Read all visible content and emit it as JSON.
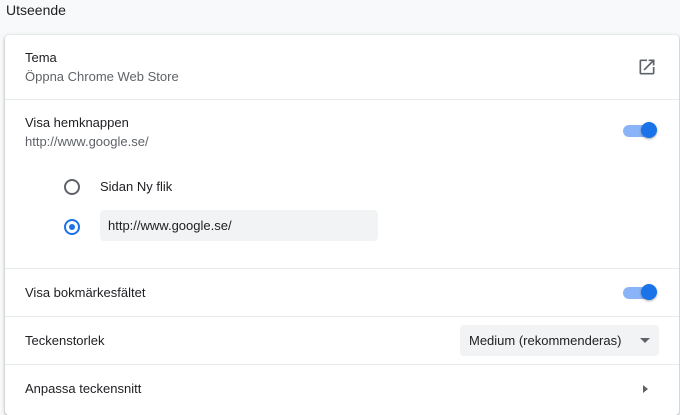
{
  "section": {
    "title": "Utseende"
  },
  "theme": {
    "title": "Tema",
    "subtitle": "Öppna Chrome Web Store",
    "icon": "open-in-new-icon"
  },
  "home_button": {
    "title": "Visa hemknappen",
    "subtitle": "http://www.google.se/",
    "enabled": true,
    "options": {
      "new_tab": {
        "label": "Sidan Ny flik",
        "selected": false
      },
      "custom_url": {
        "value": "http://www.google.se/",
        "selected": true
      }
    }
  },
  "bookmarks_bar": {
    "title": "Visa bokmärkesfältet",
    "enabled": true
  },
  "font_size": {
    "title": "Teckenstorlek",
    "selected": "Medium (rekommenderas)"
  },
  "customize_fonts": {
    "title": "Anpassa teckensnitt"
  },
  "colors": {
    "accent": "#1a73e8",
    "toggle_track": "#8ab4f8",
    "secondary_text": "#5f6368"
  }
}
